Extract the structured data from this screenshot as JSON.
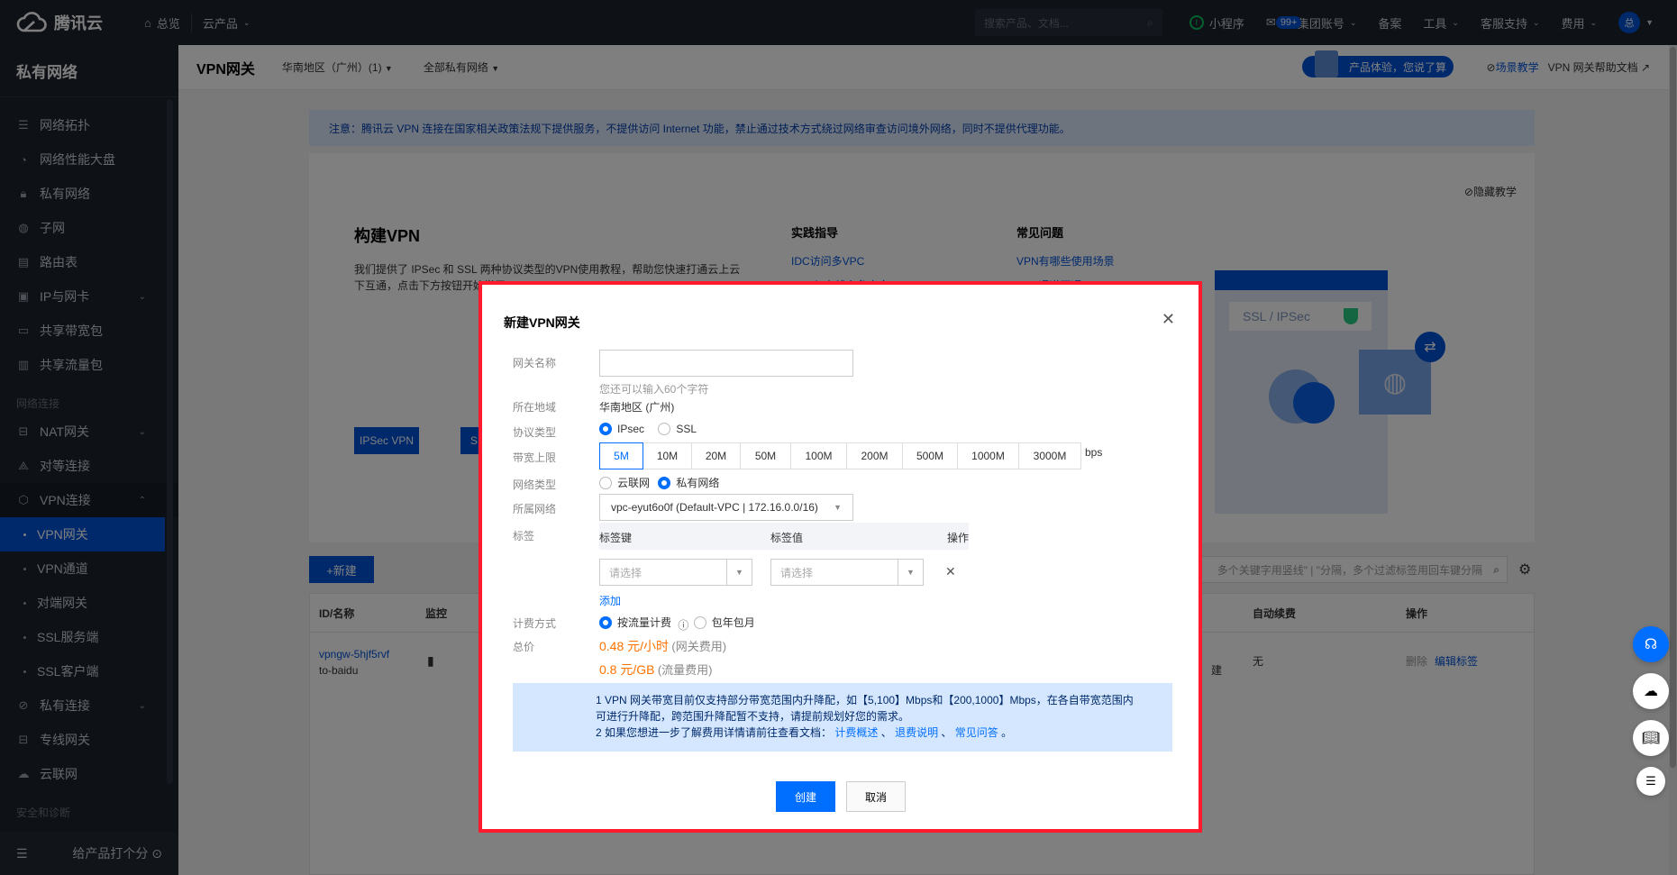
{
  "topbar": {
    "brand": "腾讯云",
    "overview": "总览",
    "products": "云产品",
    "search_placeholder": "搜索产品、文档...",
    "mini_program": "小程序",
    "mail_badge": "99+",
    "group_account": "集团账号",
    "beian": "备案",
    "tools": "工具",
    "support": "客服支持",
    "billing": "费用",
    "avatar_text": "总"
  },
  "sidebar": {
    "title": "私有网络",
    "items": [
      {
        "label": "网络拓扑",
        "icon": "topology-icon"
      },
      {
        "label": "网络性能大盘",
        "icon": "dashboard-icon"
      },
      {
        "label": "私有网络",
        "icon": "lock-icon"
      },
      {
        "label": "子网",
        "icon": "globe-icon"
      },
      {
        "label": "路由表",
        "icon": "route-table-icon"
      },
      {
        "label": "IP与网卡",
        "icon": "nic-icon",
        "expandable": true
      },
      {
        "label": "共享带宽包",
        "icon": "bandwidth-package-icon"
      },
      {
        "label": "共享流量包",
        "icon": "traffic-package-icon"
      }
    ],
    "group_network_connect": "网络连接",
    "connect_items": [
      {
        "label": "NAT网关",
        "icon": "nat-gateway-icon",
        "expandable": true
      },
      {
        "label": "对等连接",
        "icon": "peering-icon"
      },
      {
        "label": "VPN连接",
        "icon": "vpn-icon",
        "expanded": true
      }
    ],
    "vpn_sub_items": [
      {
        "label": "VPN网关",
        "active": true
      },
      {
        "label": "VPN通道"
      },
      {
        "label": "对端网关"
      },
      {
        "label": "SSL服务端"
      },
      {
        "label": "SSL客户端"
      }
    ],
    "more_items": [
      {
        "label": "私有连接",
        "icon": "private-link-icon",
        "expandable": true
      },
      {
        "label": "专线网关",
        "icon": "dc-gateway-icon"
      },
      {
        "label": "云联网",
        "icon": "ccn-icon"
      }
    ],
    "group_security": "安全和诊断",
    "rate_product": "给产品打个分"
  },
  "header": {
    "title": "VPN网关",
    "region": "华南地区（广州）(1)",
    "vpc_filter": "全部私有网络",
    "feedback": "产品体验，您说了算",
    "scenario_tutorial": "场景教学",
    "help_doc": "VPN 网关帮助文档"
  },
  "notice": "注意：腾讯云 VPN 连接在国家相关政策法规下提供服务，不提供访问 Internet 功能，禁止通过技术方式绕过网络审查访问境外网络，同时不提供代理功能。",
  "guide": {
    "title": "构建VPN",
    "desc": "我们提供了 IPSec 和 SSL 两种协议类型的VPN使用教程，帮助您快速打通云上云下互通，点击下方按钮开始学习",
    "btn_ipsec": "IPSec VPN",
    "btn_ssl": "SSL VPN",
    "practice_title": "实践指导",
    "practice_links": [
      "IDC访问多VPC",
      "VPN与专线主备容灾"
    ],
    "faq_title": "常见问题",
    "faq_links": [
      "VPN有哪些使用场景",
      "VPN通道不通"
    ],
    "hide": "隐藏教学",
    "illus_text": "SSL  /  IPSec"
  },
  "list": {
    "create_label": "+新建",
    "filter_placeholder": "多个关键字用竖线\" | \"分隔，多个过滤标签用回车键分隔",
    "columns": [
      "ID/名称",
      "监控",
      "自动续费",
      "操作"
    ],
    "rows": [
      {
        "id": "vpngw-5hjf5rvf",
        "name": "to-baidu",
        "renew": "无",
        "action_delete": "删除",
        "action_edit": "编辑标签",
        "created_partial": "建"
      }
    ]
  },
  "modal": {
    "title": "新建VPN网关",
    "fields": {
      "name_label": "网关名称",
      "name_value": "",
      "name_hint": "您还可以输入60个字符",
      "region_label": "所在地域",
      "region_value": "华南地区 (广州)",
      "protocol_label": "协议类型",
      "protocol_options": [
        {
          "label": "IPsec",
          "selected": true
        },
        {
          "label": "SSL",
          "selected": false
        }
      ],
      "bandwidth_label": "带宽上限",
      "bandwidth_options": [
        "5M",
        "10M",
        "20M",
        "50M",
        "100M",
        "200M",
        "500M",
        "1000M",
        "3000M"
      ],
      "bandwidth_selected": "5M",
      "bandwidth_unit": "bps",
      "network_type_label": "网络类型",
      "network_type_options": [
        {
          "label": "云联网",
          "selected": false
        },
        {
          "label": "私有网络",
          "selected": true
        }
      ],
      "vpc_label": "所属网络",
      "vpc_value": "vpc-eyut6o0f (Default-VPC | 172.16.0.0/16)",
      "tag_label": "标签",
      "tag_key_header": "标签键",
      "tag_value_header": "标签值",
      "tag_action_header": "操作",
      "tag_key_placeholder": "请选择",
      "tag_value_placeholder": "请选择",
      "tag_add": "添加",
      "billing_label": "计费方式",
      "billing_options": [
        {
          "label": "按流量计费",
          "selected": true
        },
        {
          "label": "包年包月",
          "selected": false
        }
      ],
      "total_label": "总价",
      "price_gateway": "0.48 元/小时",
      "price_gateway_note": "(网关费用)",
      "price_traffic": "0.8 元/GB",
      "price_traffic_note": "(流量费用)"
    },
    "tips": {
      "line1": "1 VPN 网关带宽目前仅支持部分带宽范围内升降配，如【5,100】Mbps和【200,1000】Mbps，在各自带宽范围内",
      "line1b": "可进行升降配，跨范围升降配暂不支持，请提前规划好您的需求。",
      "line2_prefix": "2 如果您想进一步了解费用详情请前往查看文档：",
      "link1": "计费概述",
      "link2": "退费说明",
      "link3": "常见问答",
      "sep": " 、",
      "end": " 。"
    },
    "ok_label": "创建",
    "cancel_label": "取消"
  },
  "colors": {
    "primary": "#006eff",
    "brand_dark": "#0052d9",
    "price": "#ff7200",
    "highlight_border": "#ff1a2e"
  }
}
